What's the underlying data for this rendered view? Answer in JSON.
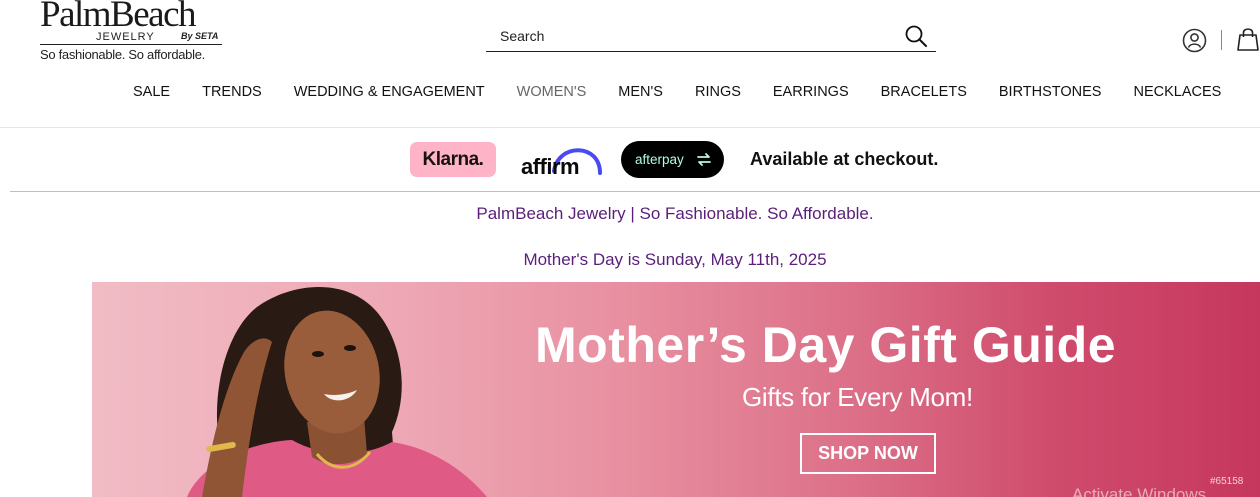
{
  "logo": {
    "main": "PalmBeach",
    "jewelry": "JEWELRY",
    "by_seta": "By SETA",
    "tagline": "So fashionable. So affordable."
  },
  "search": {
    "placeholder": "Search"
  },
  "icons": {
    "search": "search-icon",
    "account": "user-circle-icon",
    "bag": "shopping-bag-icon"
  },
  "nav": {
    "items": [
      "SALE",
      "TRENDS",
      "WEDDING & ENGAGEMENT",
      "WOMEN'S",
      "MEN'S",
      "RINGS",
      "EARRINGS",
      "BRACELETS",
      "BIRTHSTONES",
      "NECKLACES"
    ],
    "active_index": 3
  },
  "payments": {
    "klarna": "Klarna.",
    "affirm": "affirm",
    "afterpay": "afterpay",
    "available": "Available at checkout."
  },
  "headlines": {
    "tagline": "PalmBeach Jewelry | So Fashionable. So Affordable.",
    "mothers_day": "Mother's Day is Sunday, May 11th, 2025"
  },
  "banner": {
    "title": "Mother’s Day Gift Guide",
    "subtitle": "Gifts for Every Mom!",
    "cta": "SHOP NOW",
    "code": "#65158"
  },
  "overlay": {
    "watermark": "Activate Windows"
  },
  "colors": {
    "headline_purple": "#5a1f7a",
    "klarna_pink": "#ffb3c7",
    "afterpay_mint": "#b2fce4",
    "banner_left": "#f1bcc5",
    "banner_right": "#c6375d"
  }
}
